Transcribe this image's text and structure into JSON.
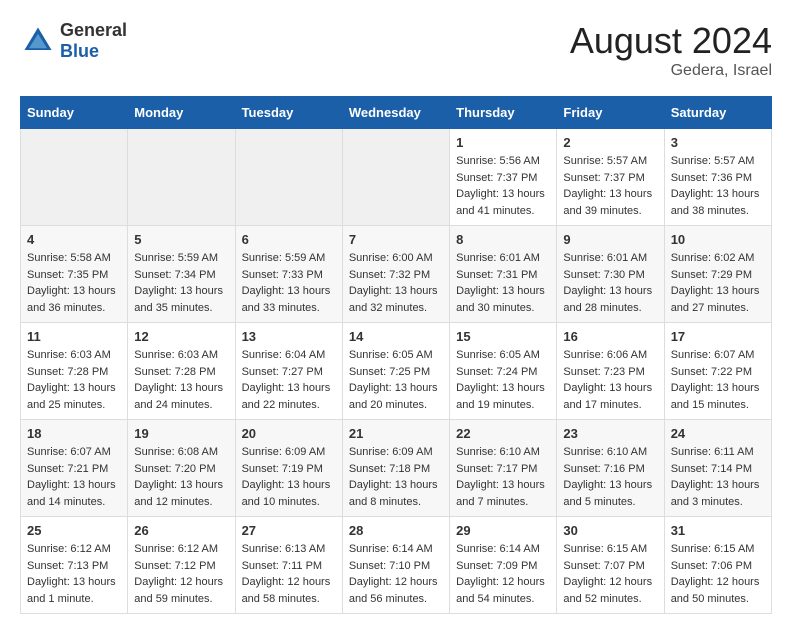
{
  "header": {
    "logo_general": "General",
    "logo_blue": "Blue",
    "month_year": "August 2024",
    "location": "Gedera, Israel"
  },
  "weekdays": [
    "Sunday",
    "Monday",
    "Tuesday",
    "Wednesday",
    "Thursday",
    "Friday",
    "Saturday"
  ],
  "weeks": [
    [
      {
        "day": "",
        "sunrise": "",
        "sunset": "",
        "daylight": "",
        "empty": true
      },
      {
        "day": "",
        "sunrise": "",
        "sunset": "",
        "daylight": "",
        "empty": true
      },
      {
        "day": "",
        "sunrise": "",
        "sunset": "",
        "daylight": "",
        "empty": true
      },
      {
        "day": "",
        "sunrise": "",
        "sunset": "",
        "daylight": "",
        "empty": true
      },
      {
        "day": "1",
        "sunrise": "Sunrise: 5:56 AM",
        "sunset": "Sunset: 7:37 PM",
        "daylight": "Daylight: 13 hours and 41 minutes.",
        "empty": false
      },
      {
        "day": "2",
        "sunrise": "Sunrise: 5:57 AM",
        "sunset": "Sunset: 7:37 PM",
        "daylight": "Daylight: 13 hours and 39 minutes.",
        "empty": false
      },
      {
        "day": "3",
        "sunrise": "Sunrise: 5:57 AM",
        "sunset": "Sunset: 7:36 PM",
        "daylight": "Daylight: 13 hours and 38 minutes.",
        "empty": false
      }
    ],
    [
      {
        "day": "4",
        "sunrise": "Sunrise: 5:58 AM",
        "sunset": "Sunset: 7:35 PM",
        "daylight": "Daylight: 13 hours and 36 minutes.",
        "empty": false
      },
      {
        "day": "5",
        "sunrise": "Sunrise: 5:59 AM",
        "sunset": "Sunset: 7:34 PM",
        "daylight": "Daylight: 13 hours and 35 minutes.",
        "empty": false
      },
      {
        "day": "6",
        "sunrise": "Sunrise: 5:59 AM",
        "sunset": "Sunset: 7:33 PM",
        "daylight": "Daylight: 13 hours and 33 minutes.",
        "empty": false
      },
      {
        "day": "7",
        "sunrise": "Sunrise: 6:00 AM",
        "sunset": "Sunset: 7:32 PM",
        "daylight": "Daylight: 13 hours and 32 minutes.",
        "empty": false
      },
      {
        "day": "8",
        "sunrise": "Sunrise: 6:01 AM",
        "sunset": "Sunset: 7:31 PM",
        "daylight": "Daylight: 13 hours and 30 minutes.",
        "empty": false
      },
      {
        "day": "9",
        "sunrise": "Sunrise: 6:01 AM",
        "sunset": "Sunset: 7:30 PM",
        "daylight": "Daylight: 13 hours and 28 minutes.",
        "empty": false
      },
      {
        "day": "10",
        "sunrise": "Sunrise: 6:02 AM",
        "sunset": "Sunset: 7:29 PM",
        "daylight": "Daylight: 13 hours and 27 minutes.",
        "empty": false
      }
    ],
    [
      {
        "day": "11",
        "sunrise": "Sunrise: 6:03 AM",
        "sunset": "Sunset: 7:28 PM",
        "daylight": "Daylight: 13 hours and 25 minutes.",
        "empty": false
      },
      {
        "day": "12",
        "sunrise": "Sunrise: 6:03 AM",
        "sunset": "Sunset: 7:28 PM",
        "daylight": "Daylight: 13 hours and 24 minutes.",
        "empty": false
      },
      {
        "day": "13",
        "sunrise": "Sunrise: 6:04 AM",
        "sunset": "Sunset: 7:27 PM",
        "daylight": "Daylight: 13 hours and 22 minutes.",
        "empty": false
      },
      {
        "day": "14",
        "sunrise": "Sunrise: 6:05 AM",
        "sunset": "Sunset: 7:25 PM",
        "daylight": "Daylight: 13 hours and 20 minutes.",
        "empty": false
      },
      {
        "day": "15",
        "sunrise": "Sunrise: 6:05 AM",
        "sunset": "Sunset: 7:24 PM",
        "daylight": "Daylight: 13 hours and 19 minutes.",
        "empty": false
      },
      {
        "day": "16",
        "sunrise": "Sunrise: 6:06 AM",
        "sunset": "Sunset: 7:23 PM",
        "daylight": "Daylight: 13 hours and 17 minutes.",
        "empty": false
      },
      {
        "day": "17",
        "sunrise": "Sunrise: 6:07 AM",
        "sunset": "Sunset: 7:22 PM",
        "daylight": "Daylight: 13 hours and 15 minutes.",
        "empty": false
      }
    ],
    [
      {
        "day": "18",
        "sunrise": "Sunrise: 6:07 AM",
        "sunset": "Sunset: 7:21 PM",
        "daylight": "Daylight: 13 hours and 14 minutes.",
        "empty": false
      },
      {
        "day": "19",
        "sunrise": "Sunrise: 6:08 AM",
        "sunset": "Sunset: 7:20 PM",
        "daylight": "Daylight: 13 hours and 12 minutes.",
        "empty": false
      },
      {
        "day": "20",
        "sunrise": "Sunrise: 6:09 AM",
        "sunset": "Sunset: 7:19 PM",
        "daylight": "Daylight: 13 hours and 10 minutes.",
        "empty": false
      },
      {
        "day": "21",
        "sunrise": "Sunrise: 6:09 AM",
        "sunset": "Sunset: 7:18 PM",
        "daylight": "Daylight: 13 hours and 8 minutes.",
        "empty": false
      },
      {
        "day": "22",
        "sunrise": "Sunrise: 6:10 AM",
        "sunset": "Sunset: 7:17 PM",
        "daylight": "Daylight: 13 hours and 7 minutes.",
        "empty": false
      },
      {
        "day": "23",
        "sunrise": "Sunrise: 6:10 AM",
        "sunset": "Sunset: 7:16 PM",
        "daylight": "Daylight: 13 hours and 5 minutes.",
        "empty": false
      },
      {
        "day": "24",
        "sunrise": "Sunrise: 6:11 AM",
        "sunset": "Sunset: 7:14 PM",
        "daylight": "Daylight: 13 hours and 3 minutes.",
        "empty": false
      }
    ],
    [
      {
        "day": "25",
        "sunrise": "Sunrise: 6:12 AM",
        "sunset": "Sunset: 7:13 PM",
        "daylight": "Daylight: 13 hours and 1 minute.",
        "empty": false
      },
      {
        "day": "26",
        "sunrise": "Sunrise: 6:12 AM",
        "sunset": "Sunset: 7:12 PM",
        "daylight": "Daylight: 12 hours and 59 minutes.",
        "empty": false
      },
      {
        "day": "27",
        "sunrise": "Sunrise: 6:13 AM",
        "sunset": "Sunset: 7:11 PM",
        "daylight": "Daylight: 12 hours and 58 minutes.",
        "empty": false
      },
      {
        "day": "28",
        "sunrise": "Sunrise: 6:14 AM",
        "sunset": "Sunset: 7:10 PM",
        "daylight": "Daylight: 12 hours and 56 minutes.",
        "empty": false
      },
      {
        "day": "29",
        "sunrise": "Sunrise: 6:14 AM",
        "sunset": "Sunset: 7:09 PM",
        "daylight": "Daylight: 12 hours and 54 minutes.",
        "empty": false
      },
      {
        "day": "30",
        "sunrise": "Sunrise: 6:15 AM",
        "sunset": "Sunset: 7:07 PM",
        "daylight": "Daylight: 12 hours and 52 minutes.",
        "empty": false
      },
      {
        "day": "31",
        "sunrise": "Sunrise: 6:15 AM",
        "sunset": "Sunset: 7:06 PM",
        "daylight": "Daylight: 12 hours and 50 minutes.",
        "empty": false
      }
    ]
  ]
}
